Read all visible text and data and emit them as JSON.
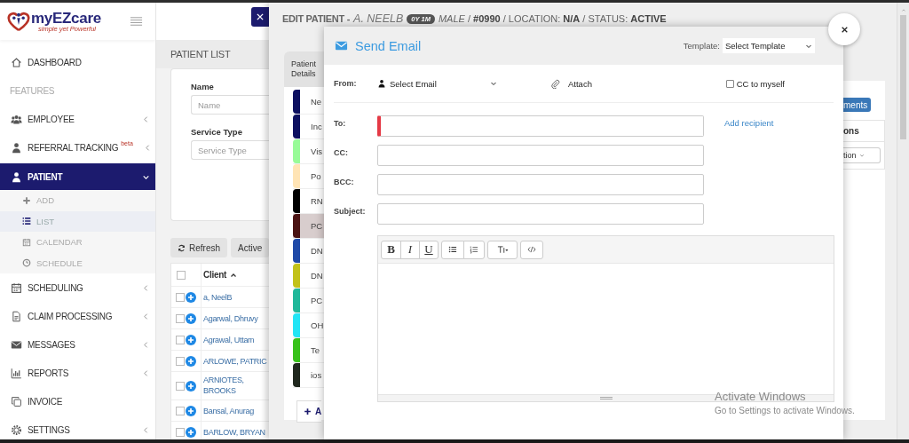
{
  "sidebar": {
    "logo": {
      "name": "myEZcare",
      "tagline": "simple yet Powerful"
    },
    "items": [
      {
        "kind": "link",
        "label": "DASHBOARD",
        "selected": false
      },
      {
        "kind": "heading",
        "label": "FEATURES"
      },
      {
        "kind": "menu",
        "label": "EMPLOYEE",
        "expanded": false,
        "selected": false
      },
      {
        "kind": "menu",
        "label": "REFERRAL TRACKING",
        "badge": "beta",
        "expanded": false,
        "selected": false
      },
      {
        "kind": "menu",
        "label": "PATIENT",
        "expanded": true,
        "selected": true,
        "children": [
          {
            "label": "ADD",
            "selected": false
          },
          {
            "label": "LIST",
            "selected": true
          },
          {
            "label": "CALENDAR",
            "selected": false
          },
          {
            "label": "SCHEDULE",
            "selected": false
          }
        ]
      },
      {
        "kind": "menu",
        "label": "SCHEDULING",
        "expanded": false,
        "selected": false
      },
      {
        "kind": "menu",
        "label": "CLAIM PROCESSING",
        "expanded": false,
        "selected": false
      },
      {
        "kind": "menu",
        "label": "MESSAGES",
        "expanded": false,
        "selected": false
      },
      {
        "kind": "menu",
        "label": "REPORTS",
        "expanded": false,
        "selected": false
      },
      {
        "kind": "link",
        "label": "INVOICE",
        "selected": false
      },
      {
        "kind": "menu",
        "label": "SETTINGS",
        "expanded": false,
        "selected": false
      }
    ]
  },
  "patient_list": {
    "title": "PATIENT LIST",
    "filters": [
      {
        "label": "Name",
        "placeholder": "Name"
      },
      {
        "label": "Service Type",
        "placeholder": "Service Type"
      }
    ],
    "buttons": [
      "Refresh",
      "Active"
    ],
    "table": {
      "select_all_checked": false,
      "columns": [
        {
          "label": "Client",
          "sorted_ascending": true
        }
      ],
      "rows": [
        {
          "client": "a, NeelB",
          "checked": false
        },
        {
          "client": "Agarwal, Dhruvy",
          "checked": false
        },
        {
          "client": "Agrawal, Uttam",
          "checked": false
        },
        {
          "client": "ARLOWE, PATRIC",
          "checked": false
        },
        {
          "client": "ARNIOTES, BROOKS",
          "checked": false
        },
        {
          "client": "Bansal, Anurag",
          "checked": false
        },
        {
          "client": "BARLOW, BRYAN",
          "checked": false
        }
      ]
    }
  },
  "edit_patient": {
    "title": "EDIT PATIENT -",
    "name": "A. NEELB",
    "age": "0Y 1M",
    "summary": "*MALE* / **#0990**  /  LOCATION: **N/A**  /  STATUS: **ACTIVE**",
    "tabs": [
      {
        "label": "Patient Details",
        "selected": true
      }
    ],
    "sections": [
      {
        "label": "Ne",
        "color": "#0d1060",
        "selected": false
      },
      {
        "label": "Inc",
        "color": "#0d1060",
        "selected": false
      },
      {
        "label": "Vis",
        "color": "#98fb98",
        "selected": false
      },
      {
        "label": "Po",
        "color": "#ffe4b5",
        "selected": false
      },
      {
        "label": "RN",
        "color": "#000000",
        "selected": false
      },
      {
        "label": "PC",
        "color": "#4a1212",
        "selected": true
      },
      {
        "label": "DN",
        "color": "#1f4aa8",
        "selected": false
      },
      {
        "label": "DN",
        "color": "#c2c21a",
        "selected": false
      },
      {
        "label": "PC",
        "color": "#20b89a",
        "selected": false
      },
      {
        "label": "OH",
        "color": "#22e5f5",
        "selected": false
      },
      {
        "label": "Te",
        "color": "#38c21a",
        "selected": false
      },
      {
        "label": "ios",
        "color": "#20281e",
        "selected": false
      }
    ],
    "add_button": "A",
    "documents_button": "ments",
    "column_header": "ons",
    "column_select": "tion"
  },
  "email": {
    "title": "Send Email",
    "template_label": "Template:",
    "template_value": "Select Template",
    "from_label": "From:",
    "from_value": "Select Email",
    "attach": "Attach",
    "cc_self": {
      "label": "CC to myself",
      "checked": false
    },
    "fields": [
      {
        "label": "To:",
        "required": true
      },
      {
        "label": "CC:",
        "required": false
      },
      {
        "label": "BCC:",
        "required": false
      },
      {
        "label": "Subject:",
        "required": false
      }
    ],
    "add_recipient": "Add recipient",
    "format_buttons": [
      "B",
      "I",
      "U"
    ]
  },
  "os_notice": {
    "title": "Activate Windows",
    "text": "Go to Settings to activate Windows."
  }
}
